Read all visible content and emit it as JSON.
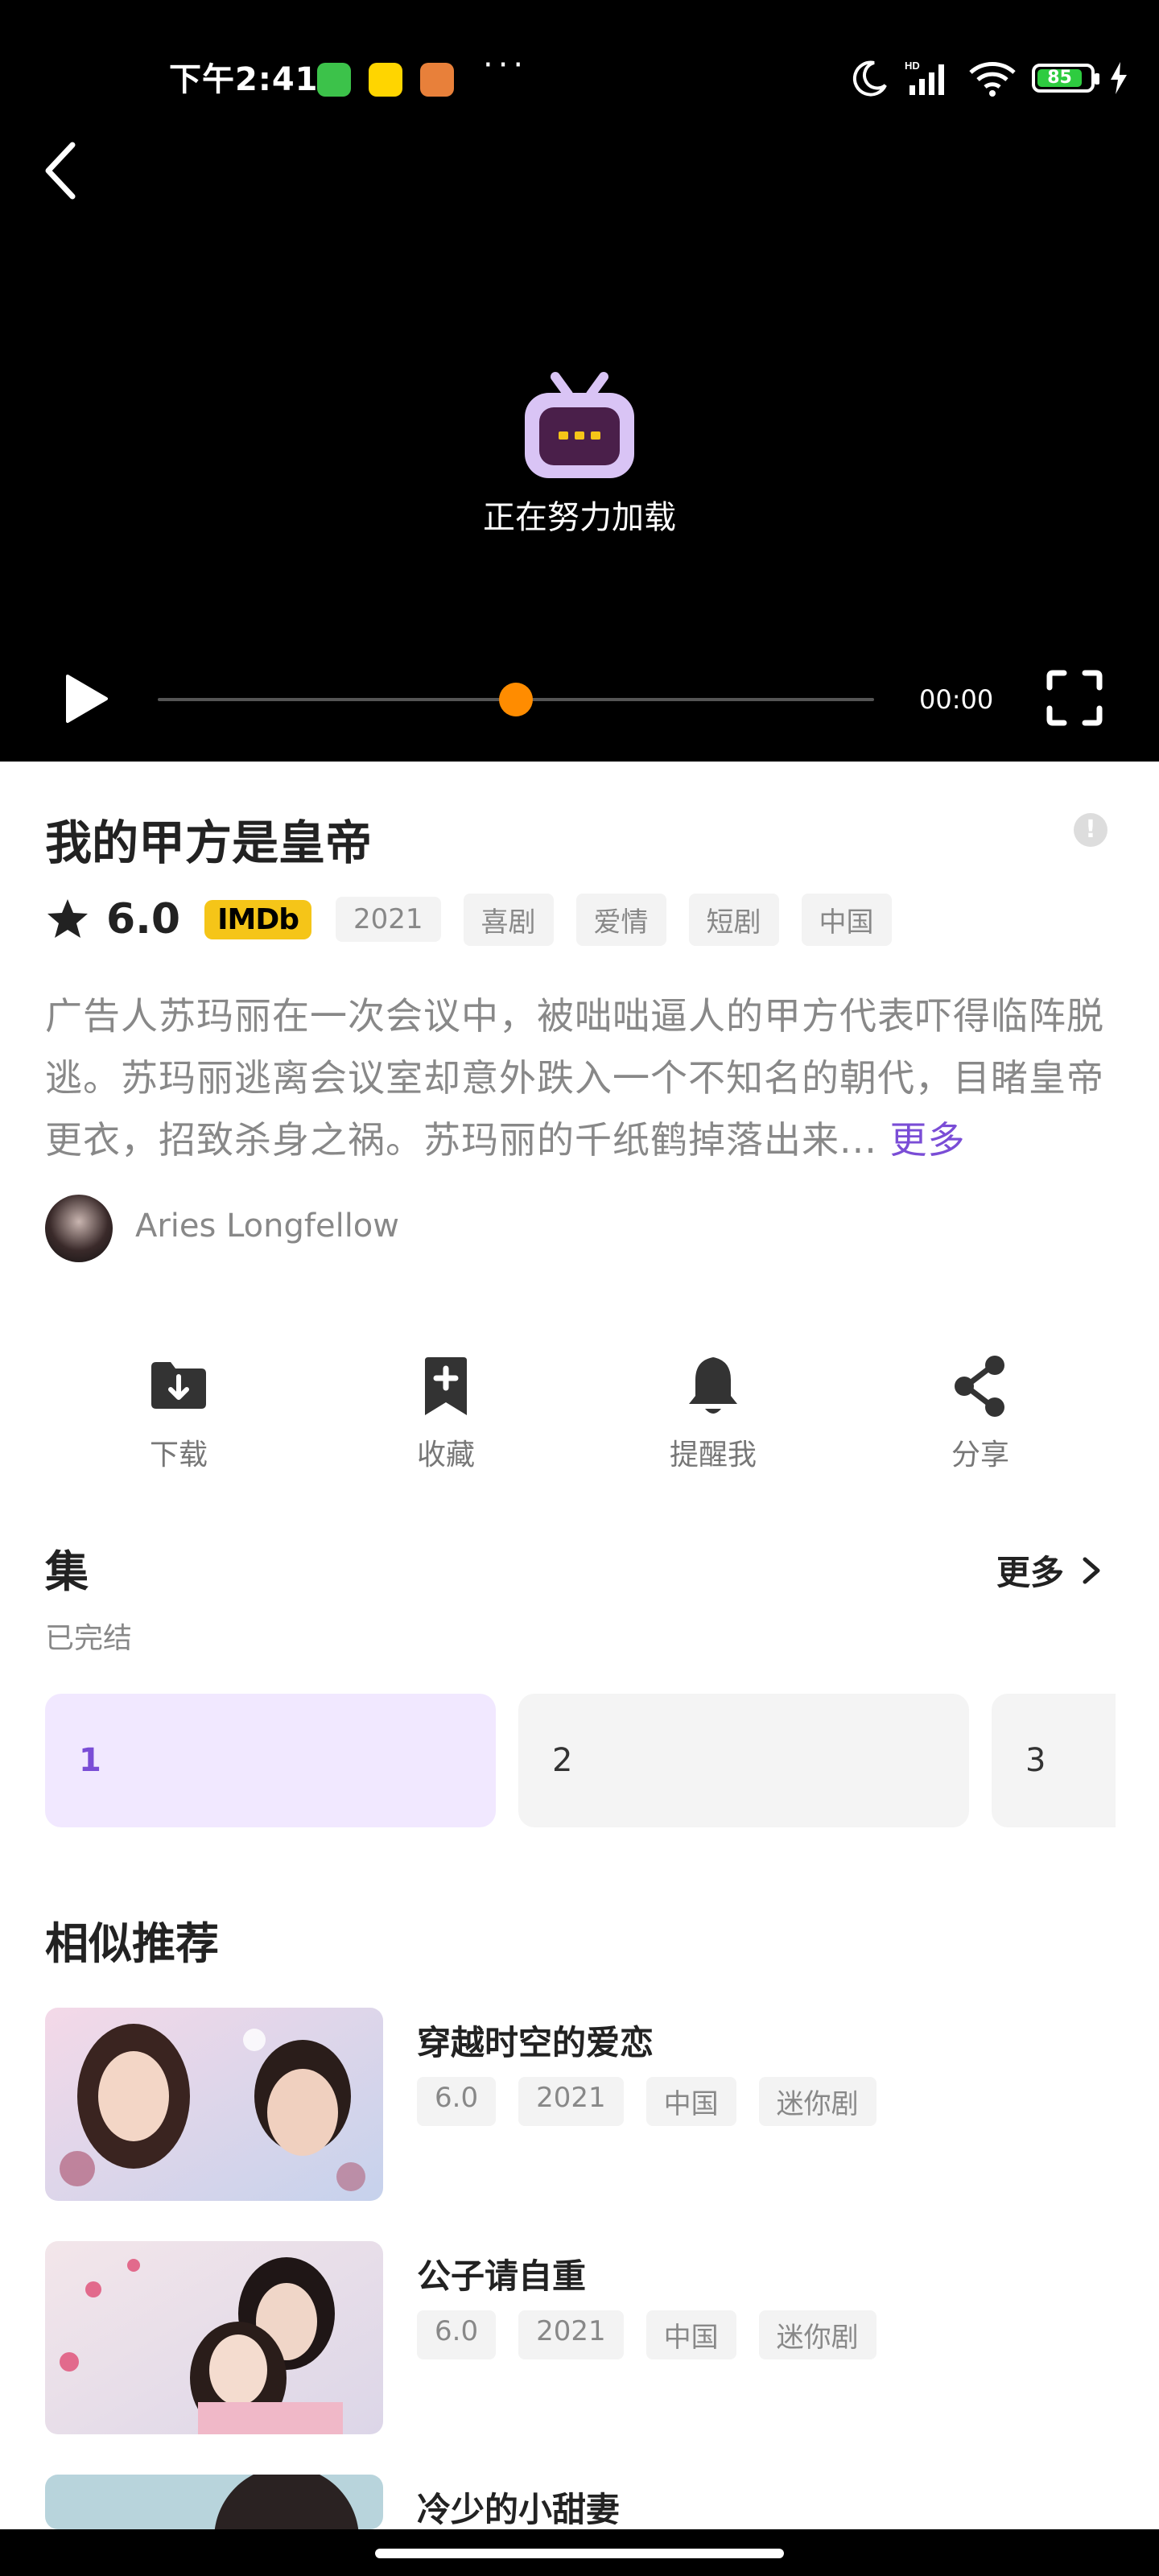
{
  "status_bar": {
    "time": "下午2:41",
    "dots": "···",
    "battery": "85"
  },
  "player": {
    "loading_text": "正在努力加载",
    "time": "00:00",
    "progress": 0.5
  },
  "show": {
    "title": "我的甲方是皇帝",
    "score": "6.0",
    "imdb_label": "IMDb",
    "tags": [
      "2021",
      "喜剧",
      "爱情",
      "短剧",
      "中国"
    ],
    "description": "广告人苏玛丽在一次会议中，被咄咄逼人的甲方代表吓得临阵脱逃。苏玛丽逃离会议室却意外跌入一个不知名的朝代，目睹皇帝更衣，招致杀身之祸。苏玛丽的千纸鹤掉落出来...",
    "more_label": "更多",
    "author": "Aries Longfellow"
  },
  "actions": {
    "download": "下载",
    "favorite": "收藏",
    "remind": "提醒我",
    "share": "分享"
  },
  "episodes": {
    "title": "集",
    "more": "更多",
    "status": "已完结",
    "items": [
      "1",
      "2",
      "3"
    ]
  },
  "recommend": {
    "title": "相似推荐",
    "items": [
      {
        "title": "穿越时空的爱恋",
        "tags": [
          "6.0",
          "2021",
          "中国",
          "迷你剧"
        ]
      },
      {
        "title": "公子请自重",
        "tags": [
          "6.0",
          "2021",
          "中国",
          "迷你剧"
        ]
      },
      {
        "title": "冷少的小甜妻",
        "tags": []
      }
    ]
  },
  "colors": {
    "accent": "#7a4dd6",
    "progress_knob": "#ff8c00",
    "imdb": "#f5c518"
  }
}
